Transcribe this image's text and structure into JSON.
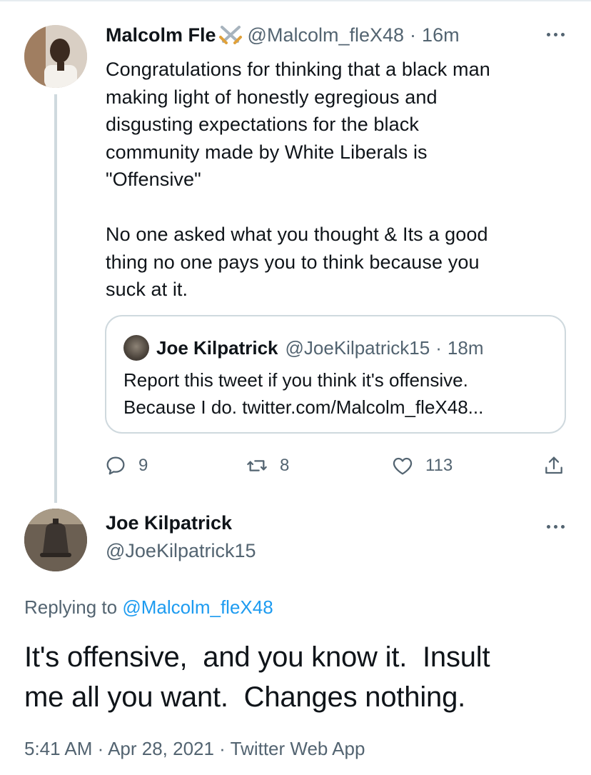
{
  "colors": {
    "text": "#0f1419",
    "muted": "#536471",
    "link": "#1d9bf0",
    "border": "#cfd9de"
  },
  "parent_tweet": {
    "display_name": "Malcolm Fle",
    "name_emoji": "crossed-swords-icon",
    "handle": "@Malcolm_fleX48",
    "separator": "·",
    "time": "16m",
    "text": "Congratulations for thinking that a black man\nmaking light of honestly egregious and\ndisgusting expectations for the black\ncommunity made by White Liberals is\n\"Offensive\"\n\nNo one asked what you thought & Its a good\nthing no one pays you to think because you\nsuck at it.",
    "quoted": {
      "display_name": "Joe Kilpatrick",
      "handle": "@JoeKilpatrick15",
      "separator": "·",
      "time": "18m",
      "text": "Report this tweet if you think it's offensive.\nBecause I do. twitter.com/Malcolm_fleX48..."
    },
    "actions": {
      "replies": "9",
      "retweets": "8",
      "likes": "113"
    }
  },
  "reply_tweet": {
    "display_name": "Joe Kilpatrick",
    "handle": "@JoeKilpatrick15",
    "replying_prefix": "Replying to",
    "replying_handle": "@Malcolm_fleX48",
    "text": "It's offensive,  and you know it.  Insult\nme all you want.  Changes nothing.",
    "timestamp": "5:41 AM · Apr 28, 2021 · Twitter Web App"
  }
}
